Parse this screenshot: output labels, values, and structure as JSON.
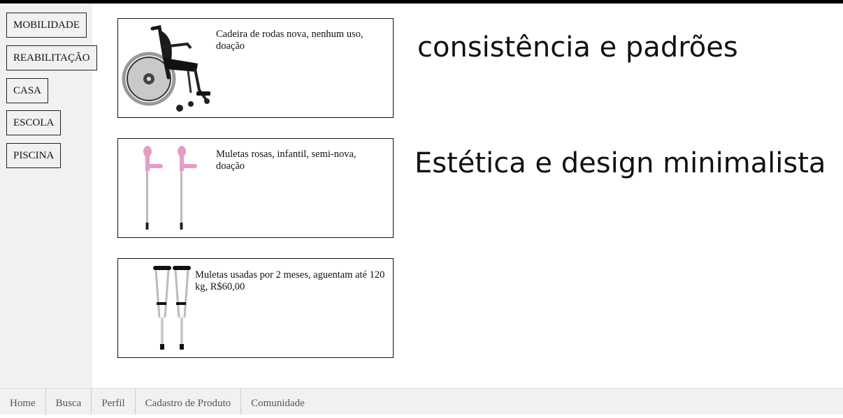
{
  "sidebar": {
    "categories": [
      "MOBILIDADE",
      "REABILITAÇÃO",
      "CASA",
      "ESCOLA",
      "PISCINA"
    ]
  },
  "products": [
    {
      "description": "Cadeira de rodas nova, nenhum uso, doação",
      "image": "wheelchair-image"
    },
    {
      "description": "Muletas rosas, infantil, semi-nova, doação",
      "image": "pink-crutches-image"
    },
    {
      "description": "Muletas usadas por 2 meses, aguentam até 120 kg, R$60,00",
      "image": "crutches-image"
    }
  ],
  "headings": {
    "first": "consistência e padrões",
    "second": "Estética e design minimalista"
  },
  "bottom_nav": [
    "Home",
    "Busca",
    "Perfil",
    "Cadastro de Produto",
    "Comunidade"
  ],
  "colors": {
    "sidebar_bg": "#f1f1f1",
    "crutch_pink": "#e79cc8",
    "wheelchair_black": "#1a1a1a"
  }
}
